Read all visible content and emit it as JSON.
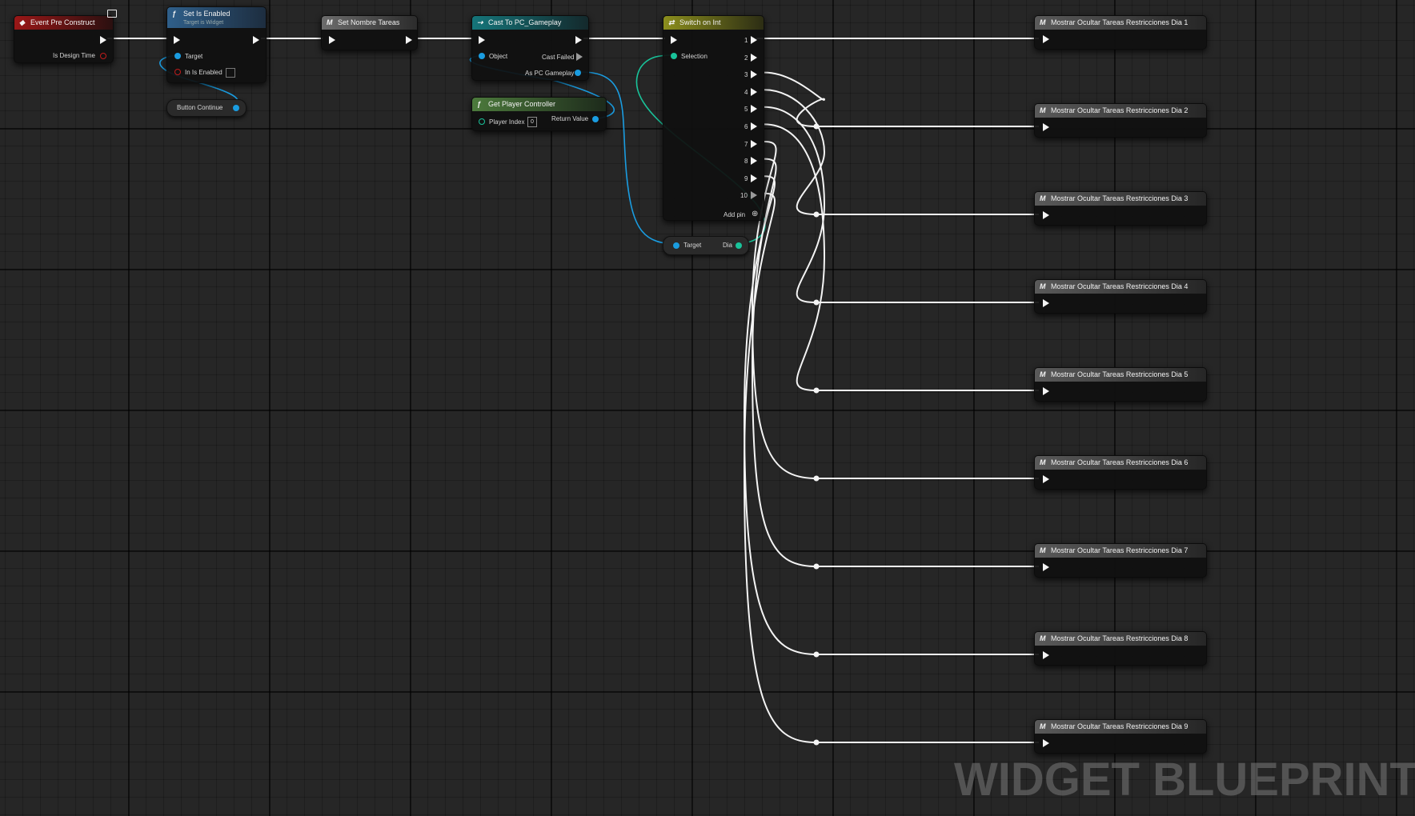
{
  "graph_type": "Widget Blueprint event graph",
  "watermark": "WIDGET BLUEPRINT",
  "nodes": {
    "event_pre_construct": {
      "title": "Event Pre Construct",
      "pin_is_design_time": "Is Design Time"
    },
    "set_is_enabled": {
      "title": "Set Is Enabled",
      "subtitle": "Target is Widget",
      "pin_target": "Target",
      "pin_in_is_enabled": "In Is Enabled"
    },
    "button_continue": {
      "label": "Button Continue"
    },
    "set_nombre_tareas": {
      "title": "Set Nombre Tareas"
    },
    "cast_to_pc_gameplay": {
      "title": "Cast To PC_Gameplay",
      "pin_object": "Object",
      "pin_cast_failed": "Cast Failed",
      "pin_as_pc_gameplay": "As PC Gameplay"
    },
    "get_player_controller": {
      "title": "Get Player Controller",
      "pin_player_index": "Player Index",
      "player_index_value": "0",
      "pin_return_value": "Return Value"
    },
    "switch_on_int": {
      "title": "Switch on Int",
      "pin_selection": "Selection",
      "outputs": [
        "1",
        "2",
        "3",
        "4",
        "5",
        "6",
        "7",
        "8",
        "9",
        "10"
      ],
      "add_pin": "Add pin"
    },
    "dia_getter": {
      "pin_target": "Target",
      "pin_dia": "Dia"
    },
    "mostrar_nodes": [
      {
        "title": "Mostrar Ocultar Tareas Restricciones Dia 1"
      },
      {
        "title": "Mostrar Ocultar Tareas Restricciones Dia 2"
      },
      {
        "title": "Mostrar Ocultar Tareas Restricciones Dia 3"
      },
      {
        "title": "Mostrar Ocultar Tareas Restricciones Dia 4"
      },
      {
        "title": "Mostrar Ocultar Tareas Restricciones Dia 5"
      },
      {
        "title": "Mostrar Ocultar Tareas Restricciones Dia 6"
      },
      {
        "title": "Mostrar Ocultar Tareas Restricciones Dia 7"
      },
      {
        "title": "Mostrar Ocultar Tareas Restricciones Dia 8"
      },
      {
        "title": "Mostrar Ocultar Tareas Restricciones Dia 9"
      }
    ]
  },
  "colors": {
    "exec_wire": "#f4f4f4",
    "object_wire": "#1a9ce0",
    "int_wire": "#19c39a",
    "event_header": "#9a1717",
    "function_header": "#2f5f8a",
    "cast_header": "#15757a",
    "pure_header": "#4c7a3c",
    "switch_header": "#8b8e1d",
    "macro_header": "#6c6c6c"
  },
  "icons": {
    "event": "event-diamond-icon",
    "function": "function-f-icon",
    "macro": "macro-m-icon",
    "cast": "cast-arrows-icon",
    "switch": "switch-icon",
    "screen": "screen-icon"
  }
}
